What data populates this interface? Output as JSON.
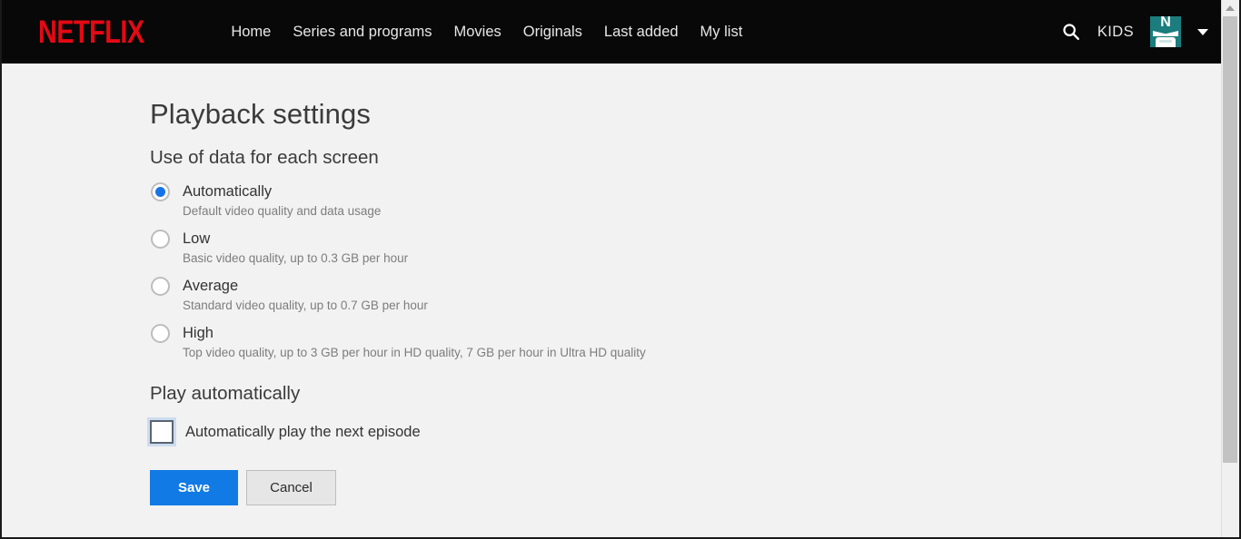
{
  "header": {
    "brand": "NETFLIX",
    "nav_items": [
      {
        "label": "Home"
      },
      {
        "label": "Series and programs"
      },
      {
        "label": "Movies"
      },
      {
        "label": "Originals"
      },
      {
        "label": "Last added"
      },
      {
        "label": "My list"
      }
    ],
    "search_icon": "search-icon",
    "kids_label": "KIDS",
    "avatar": {
      "icon": "profile-avatar-icon",
      "letter": "N",
      "background_color": "#1b7d7d"
    },
    "caret_icon": "chevron-down-icon",
    "background_color": "#080808",
    "brand_color": "#e50914"
  },
  "main": {
    "page_title": "Playback settings",
    "data_usage": {
      "section_title": "Use of data for each screen",
      "selected": "Automatically",
      "options": [
        {
          "label": "Automatically",
          "description": "Default video quality and data usage",
          "checked": true
        },
        {
          "label": "Low",
          "description": "Basic video quality, up to 0.3 GB per hour",
          "checked": false
        },
        {
          "label": "Average",
          "description": "Standard video quality, up to 0.7 GB per hour",
          "checked": false
        },
        {
          "label": "High",
          "description": "Top video quality, up to 3 GB per hour in HD quality, 7 GB per hour in Ultra HD quality",
          "checked": false
        }
      ],
      "accent_color": "#1673e8"
    },
    "autoplay": {
      "section_title": "Play automatically",
      "checkbox_label": "Automatically play the next episode",
      "checked": false
    },
    "actions": {
      "save_label": "Save",
      "cancel_label": "Cancel",
      "save_color": "#117ae5"
    }
  },
  "scrollbar": {
    "up_arrow_icon": "scroll-up-arrow-icon",
    "thumb": "scroll-thumb"
  }
}
